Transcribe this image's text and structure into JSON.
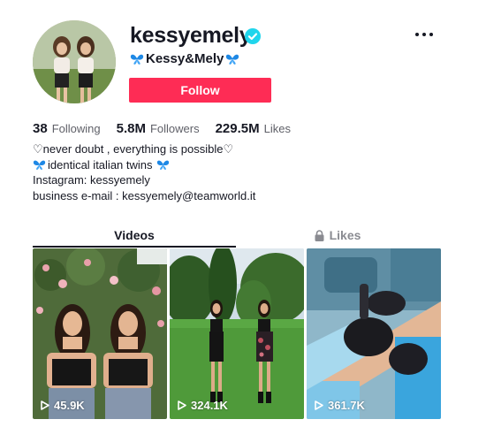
{
  "profile": {
    "username": "kessyemely",
    "nickname": "Kessy&Mely",
    "verified": true,
    "follow_label": "Follow",
    "accent_color": "#fe2c55",
    "verified_color": "#20d5ec"
  },
  "stats": {
    "following_count": "38",
    "following_label": "Following",
    "followers_count": "5.8M",
    "followers_label": "Followers",
    "likes_count": "229.5M",
    "likes_label": "Likes"
  },
  "bio": {
    "line1": "♡never doubt , everything is possible♡",
    "line2": "identical italian twins",
    "line3": "Instagram: kessyemely",
    "line4": "business e-mail : kessyemely@teamworld.it"
  },
  "tabs": {
    "videos_label": "Videos",
    "likes_label": "Likes",
    "active": "videos"
  },
  "videos": [
    {
      "views": "45.9K"
    },
    {
      "views": "324.1K"
    },
    {
      "views": "361.7K"
    }
  ],
  "icons": [
    "verified-badge-icon",
    "butterfly-icon",
    "more-dots-icon",
    "lock-icon",
    "play-icon"
  ]
}
